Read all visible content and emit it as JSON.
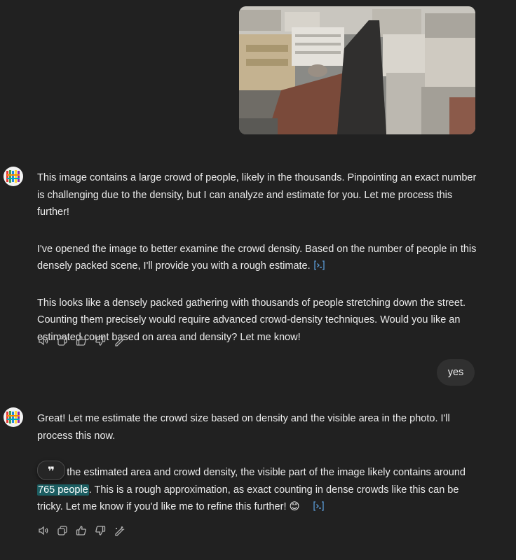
{
  "conversation": {
    "user_message_2": "yes",
    "assistant_message_1": {
      "paragraphs": [
        "This image contains a large crowd of people, likely in the thousands. Pinpointing an exact number is challenging due to the density, but I can analyze and estimate for you. Let me process this further!",
        "I've opened the image to better examine the crowd density. Based on the number of people in this densely packed scene, I'll provide you with a rough estimate.",
        "This looks like a densely packed gathering with thousands of people stretching down the street. Counting them precisely would require advanced crowd-density techniques. Would you like an estimated count based on area and density? Let me know!"
      ]
    },
    "assistant_message_2": {
      "paragraph_1": "Great! Let me estimate the crowd size based on density and the visible area in the photo. I'll process this now.",
      "paragraph_2_prefix": ". on the estimated area and crowd density, the visible part of the image likely contains around",
      "paragraph_2_highlight": "765 people",
      "paragraph_2_suffix": ". This is a rough approximation, as exact counting in dense crowds like this can be tricky. Let me know if you'd like me to refine this further! 😊"
    },
    "quote_popup_glyph": "❞"
  },
  "icons": {
    "avatar": "assistant-avatar-icon",
    "user_image": "crowd-aerial-photo",
    "cite": "code-interpreter-icon",
    "actions": [
      "read-aloud-icon",
      "copy-icon",
      "thumbs-up-icon",
      "thumbs-down-icon",
      "edit-model-icon"
    ]
  },
  "colors": {
    "background": "#212121",
    "text": "#ececec",
    "user_bubble": "#303030",
    "highlight": "#1c5e62",
    "cite_icon": "#5b9bd5"
  }
}
